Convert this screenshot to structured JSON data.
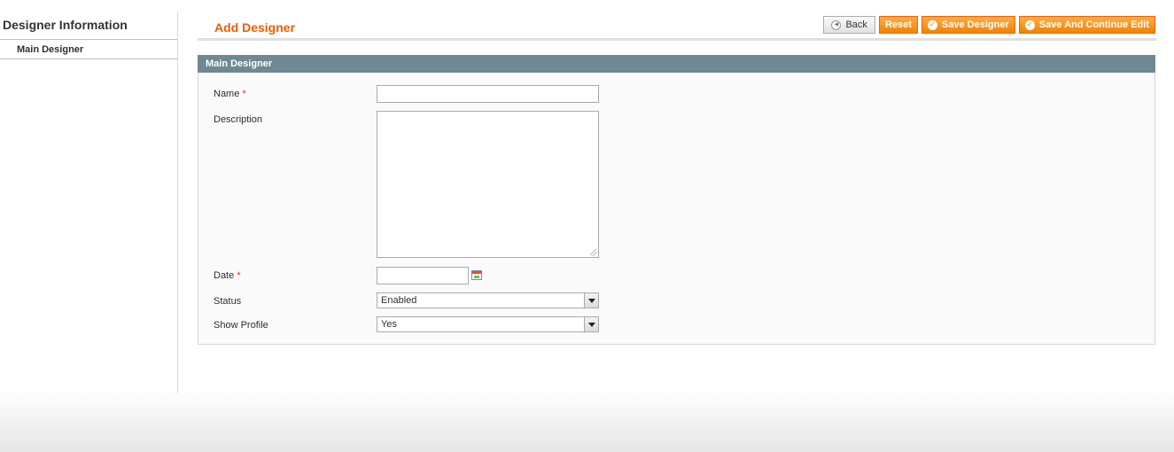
{
  "sidebar": {
    "title": "Designer Information",
    "items": [
      {
        "label": "Main Designer"
      }
    ]
  },
  "header": {
    "title": "Add Designer",
    "buttons": {
      "back": "Back",
      "reset": "Reset",
      "save": "Save Designer",
      "save_continue": "Save And Continue Edit"
    }
  },
  "fieldset": {
    "title": "Main Designer",
    "fields": {
      "name": {
        "label": "Name",
        "required_mark": "*",
        "value": ""
      },
      "description": {
        "label": "Description",
        "value": ""
      },
      "date": {
        "label": "Date",
        "required_mark": "*",
        "value": ""
      },
      "status": {
        "label": "Status",
        "value": "Enabled"
      },
      "show_profile": {
        "label": "Show Profile",
        "value": "Yes"
      }
    }
  },
  "colors": {
    "accent": "#eb5e00",
    "button_orange": "#f18200",
    "fieldset_header": "#6f8992",
    "required": "#eb340a"
  },
  "icons": [
    "back-arrow-icon",
    "checkmark-icon",
    "calendar-icon",
    "chevron-down-icon",
    "resize-handle-icon"
  ]
}
